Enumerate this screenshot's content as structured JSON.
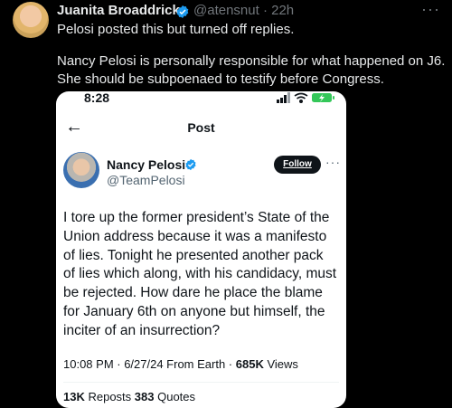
{
  "outer_tweet": {
    "author_name": "Juanita Broaddrick",
    "handle_time": "@atensnut · 22h",
    "more": "···",
    "text_lines": [
      "Pelosi posted this but turned off replies.",
      "",
      "Nancy Pelosi is personally responsible for what happened on J6.",
      "She should be subpoenaed to testify before Congress."
    ]
  },
  "embedded": {
    "status_time": "8:28",
    "back_icon": "←",
    "title": "Post",
    "author_name": "Nancy Pelosi",
    "handle": "@TeamPelosi",
    "follow_label": "Follow",
    "more": "···",
    "body_lines": [
      "I tore up the former president’s State of the",
      "Union address because it was a manifesto",
      "of lies. Tonight he presented another pack",
      "of lies which along, with his candidacy, must",
      "be rejected. How dare he place the blame",
      "for January 6th on anyone but himself, the",
      "inciter of an insurrection?"
    ],
    "meta_time": "10:08 PM · 6/27/24 From Earth · ",
    "views_count": "685K",
    "views_label": " Views",
    "reposts_count": "13K",
    "reposts_label": " Reposts ",
    "quotes_count": "383",
    "quotes_label": " Quotes"
  },
  "colors": {
    "verified": "#1d9bf0",
    "muted": "#71767b",
    "background": "#000000"
  },
  "icons": [
    "verified-badge-icon",
    "back-arrow-icon",
    "signal-icon",
    "wifi-icon",
    "battery-icon"
  ]
}
